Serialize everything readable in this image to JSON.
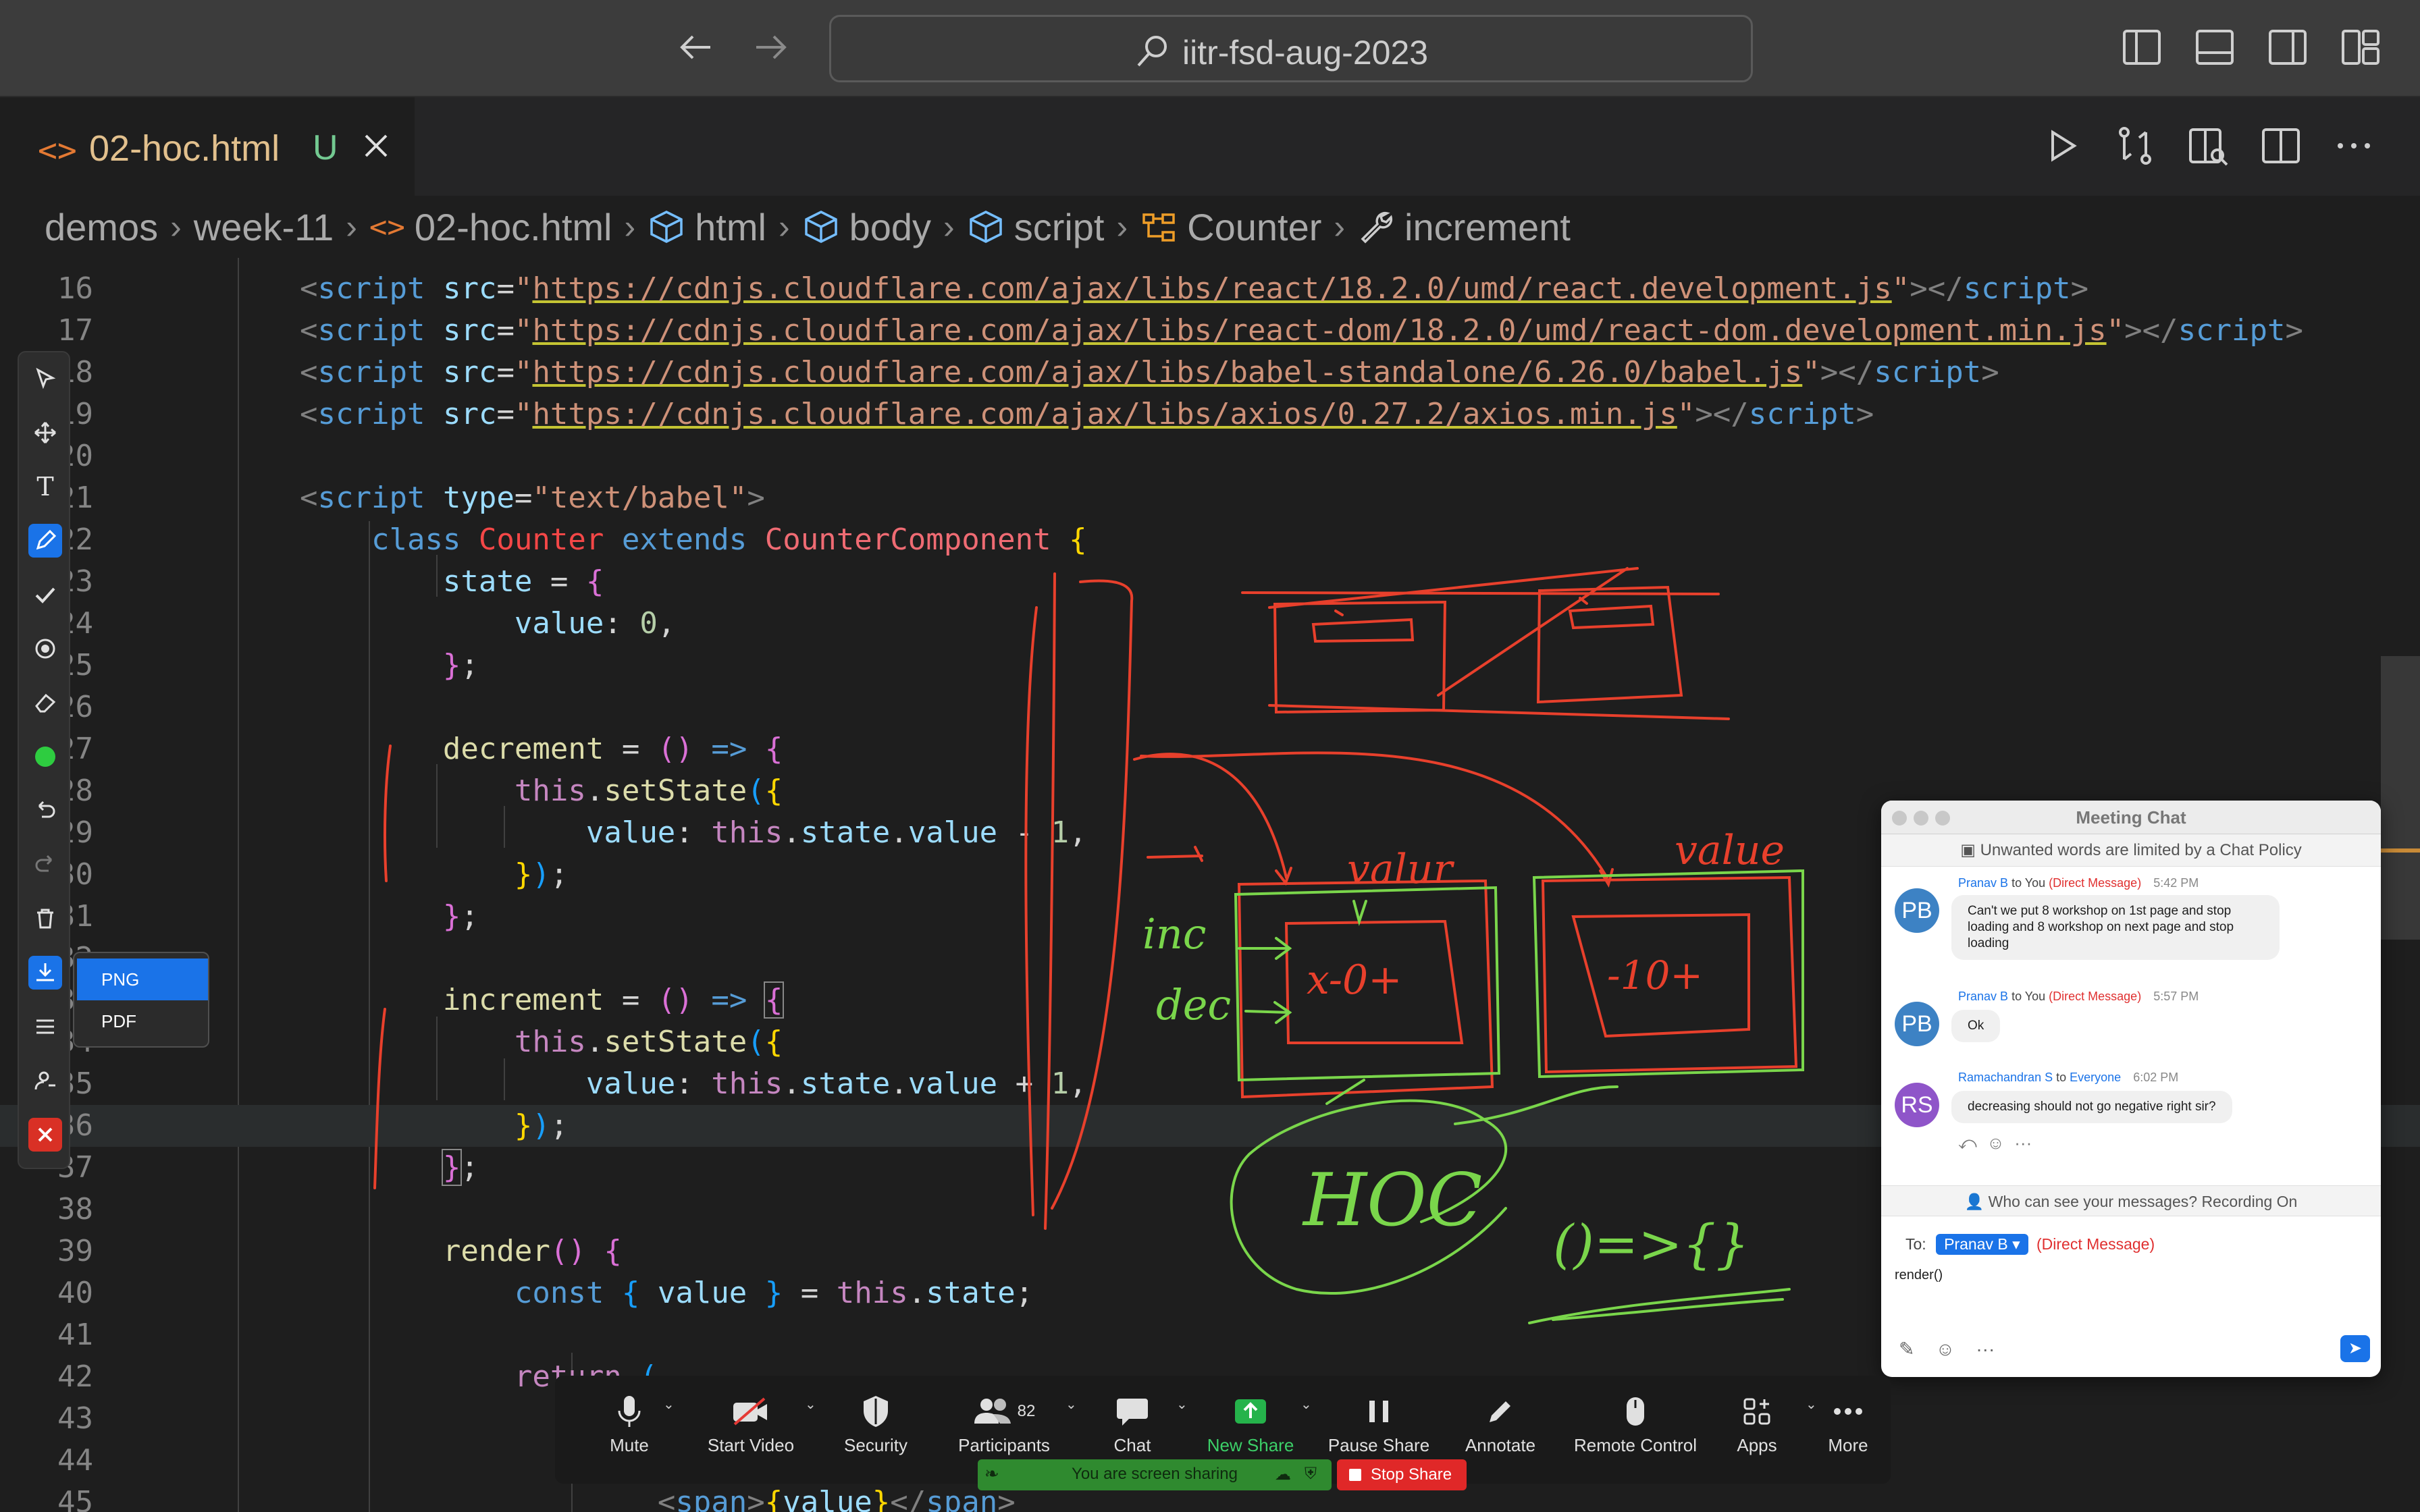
{
  "titlebar": {
    "search": "iitr-fsd-aug-2023"
  },
  "tab": {
    "icon": "<>",
    "filename": "02-hoc.html",
    "status": "U"
  },
  "breadcrumb": {
    "items": [
      "demos",
      "week-11",
      "02-hoc.html",
      "html",
      "body",
      "script",
      "Counter",
      "increment"
    ]
  },
  "editor": {
    "line_numbers": [
      "16",
      "17",
      "18",
      "19",
      "20",
      "21",
      "22",
      "23",
      "24",
      "25",
      "26",
      "27",
      "28",
      "29",
      "30",
      "31",
      "32",
      "33",
      "34",
      "35",
      "36",
      "37",
      "38",
      "39",
      "40",
      "41",
      "42",
      "43",
      "44",
      "45"
    ],
    "current_line": "36",
    "scripts": [
      "https://cdnjs.cloudflare.com/ajax/libs/react/18.2.0/umd/react.development.js",
      "https://cdnjs.cloudflare.com/ajax/libs/react-dom/18.2.0/umd/react-dom.development.min.js",
      "https://cdnjs.cloudflare.com/ajax/libs/babel-standalone/6.26.0/babel.js",
      "https://cdnjs.cloudflare.com/ajax/libs/axios/0.27.2/axios.min.js"
    ],
    "script_type": "text/babel",
    "class_name": "Counter",
    "extends_name": "CounterComponent"
  },
  "annotate_menu": {
    "options": [
      "PNG",
      "PDF"
    ],
    "selected": "PNG",
    "tools": [
      "select-icon",
      "move-icon",
      "text-icon",
      "pen-icon",
      "stamp-check-icon",
      "spotlight-icon",
      "eraser-icon",
      "color-dot-icon",
      "undo-icon",
      "redo-icon",
      "trash-icon",
      "save-icon",
      "menu-icon",
      "user-icon",
      "close-icon"
    ],
    "active_color": "#2ecc40"
  },
  "handwriting": {
    "labels": [
      "valur",
      "value",
      "inc",
      "dec",
      "x-0+",
      "-10+",
      "HOC",
      "()=>{}"
    ]
  },
  "chat": {
    "title": "Meeting Chat",
    "policy": "Unwanted words are limited by a Chat Policy",
    "messages": [
      {
        "initials": "PB",
        "avatar_color": "#3d82c4",
        "from": "Pranav B",
        "to": "You",
        "dm": "(Direct Message)",
        "time": "5:42 PM",
        "text": "Can't we put 8 workshop on 1st page and stop loading and 8 workshop on next page and stop loading"
      },
      {
        "initials": "PB",
        "avatar_color": "#3d82c4",
        "from": "Pranav B",
        "to": "You",
        "dm": "(Direct Message)",
        "time": "5:57 PM",
        "text": "Ok"
      },
      {
        "initials": "RS",
        "avatar_color": "#8f55c9",
        "from": "Ramachandran S",
        "to": "Everyone",
        "dm": "",
        "time": "6:02 PM",
        "text": "decreasing should not go negative right sir?"
      }
    ],
    "who_can_see": "Who can see your messages? Recording On",
    "to_label": "To:",
    "recipient": "Pranav B",
    "recipient_dm": "(Direct Message)",
    "draft": "render()",
    "word_to": "to"
  },
  "zoom": {
    "items": [
      {
        "label": "Mute",
        "icon": "microphone-icon"
      },
      {
        "label": "Start Video",
        "icon": "video-off-icon"
      },
      {
        "label": "Security",
        "icon": "shield-icon"
      },
      {
        "label": "Participants",
        "icon": "participants-icon",
        "count": "82"
      },
      {
        "label": "Chat",
        "icon": "chat-icon"
      },
      {
        "label": "New Share",
        "icon": "share-icon"
      },
      {
        "label": "Pause Share",
        "icon": "pause-icon"
      },
      {
        "label": "Annotate",
        "icon": "pencil-icon"
      },
      {
        "label": "Remote Control",
        "icon": "mouse-icon"
      },
      {
        "label": "Apps",
        "icon": "apps-icon"
      },
      {
        "label": "More",
        "icon": "more-icon"
      }
    ],
    "sharing_text": "You are screen sharing",
    "stop_share": "Stop Share"
  }
}
